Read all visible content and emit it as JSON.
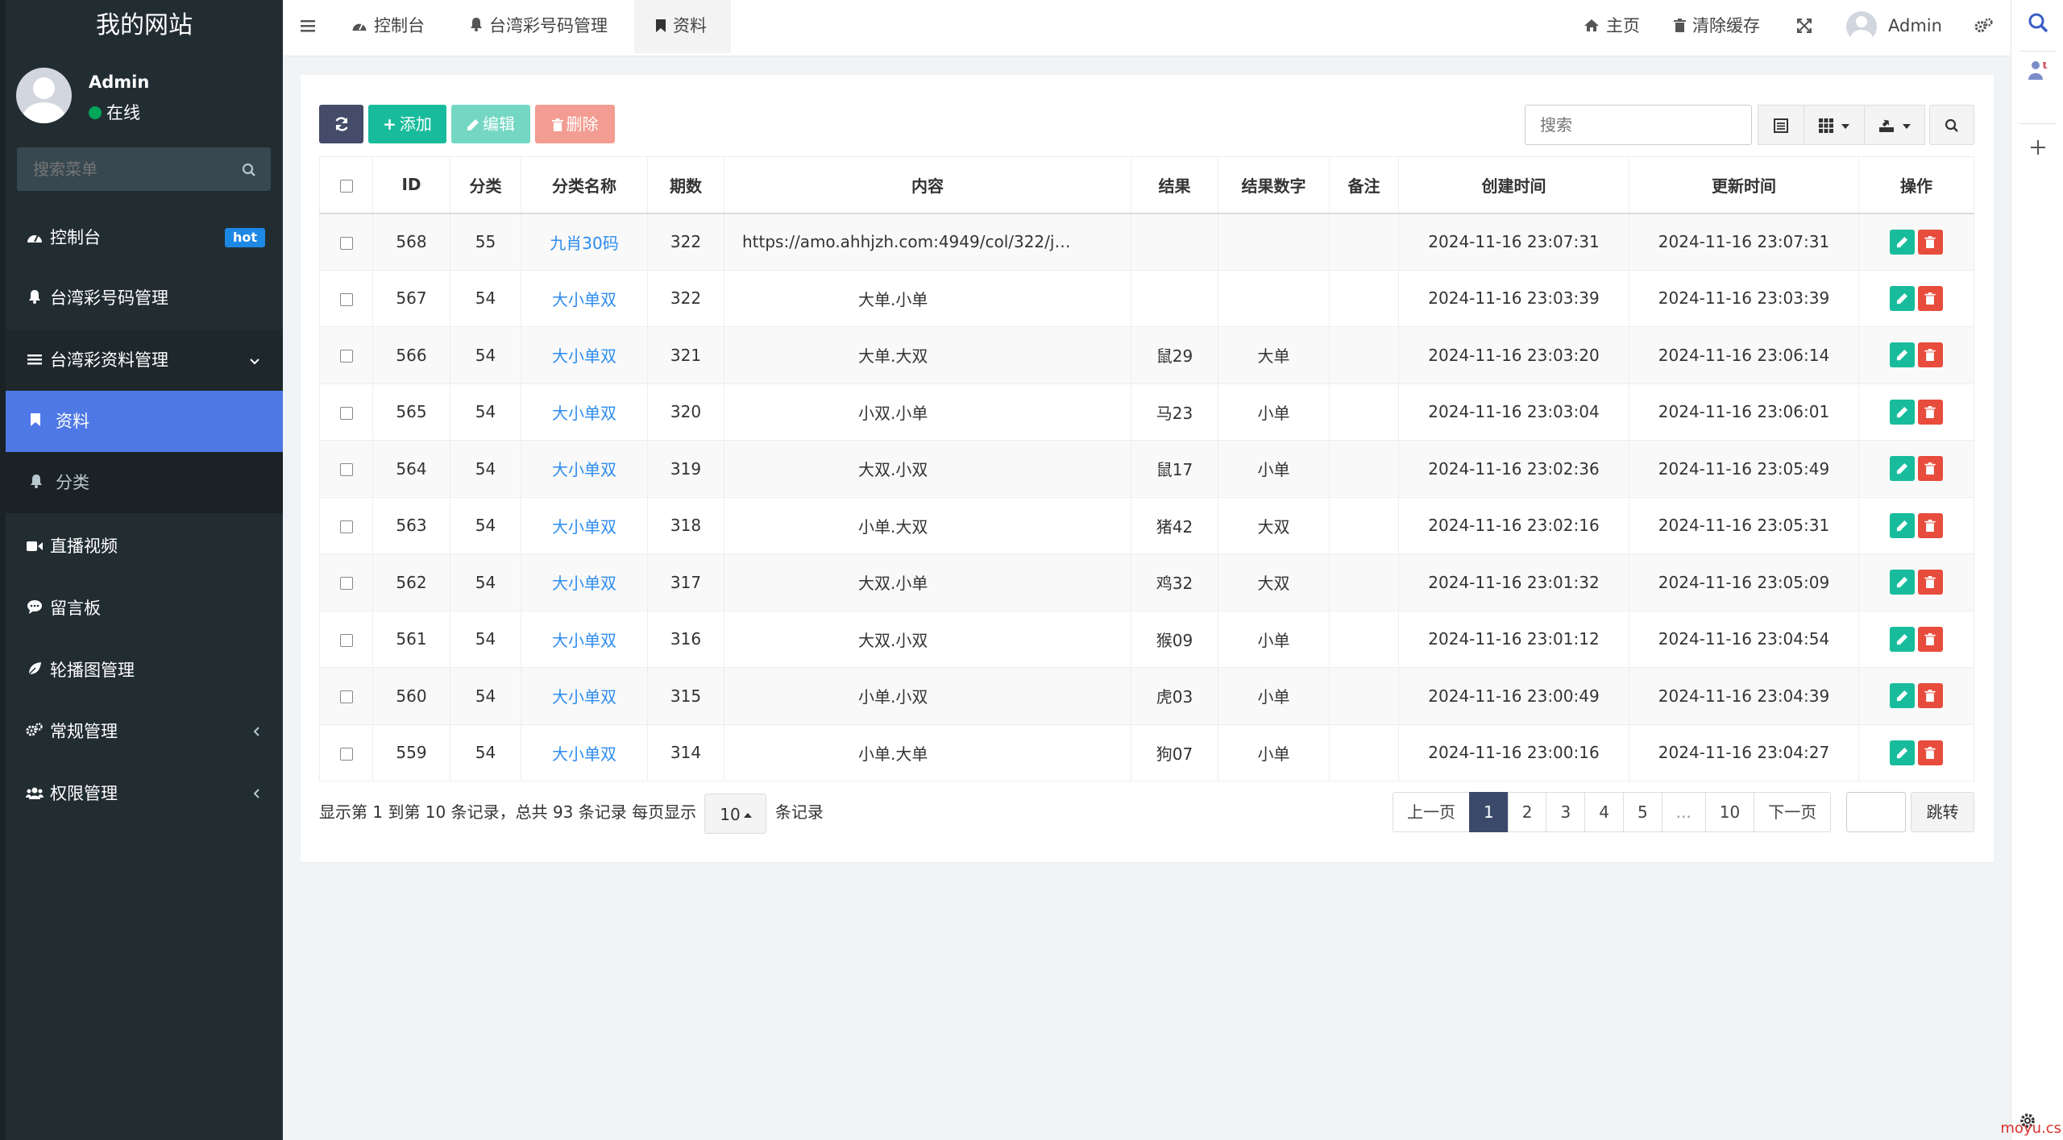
{
  "site_title": "我的网站",
  "user": {
    "name": "Admin",
    "status": "在线"
  },
  "sidebar": {
    "search_placeholder": "搜索菜单",
    "items": [
      {
        "label": "控制台",
        "icon": "dashboard-icon",
        "badge": "hot"
      },
      {
        "label": "台湾彩号码管理",
        "icon": "bell-icon"
      },
      {
        "label": "台湾彩资料管理",
        "icon": "list-icon"
      },
      {
        "label": "资料",
        "icon": "bookmark-icon"
      },
      {
        "label": "分类",
        "icon": "bell-icon"
      },
      {
        "label": "直播视频",
        "icon": "video-icon"
      },
      {
        "label": "留言板",
        "icon": "comment-icon"
      },
      {
        "label": "轮播图管理",
        "icon": "leaf-icon"
      },
      {
        "label": "常规管理",
        "icon": "cogs-icon"
      },
      {
        "label": "权限管理",
        "icon": "users-icon"
      }
    ]
  },
  "topbar": {
    "tabs": [
      {
        "label": "控制台",
        "icon": "dashboard-icon"
      },
      {
        "label": "台湾彩号码管理",
        "icon": "bell-icon"
      },
      {
        "label": "资料",
        "icon": "bookmark-icon"
      }
    ],
    "home": "主页",
    "clear_cache": "清除缓存",
    "admin": "Admin"
  },
  "toolbar": {
    "add": "添加",
    "edit": "编辑",
    "delete": "删除",
    "search_placeholder": "搜索"
  },
  "table": {
    "headers": [
      "ID",
      "分类",
      "分类名称",
      "期数",
      "内容",
      "结果",
      "结果数字",
      "备注",
      "创建时间",
      "更新时间",
      "操作"
    ],
    "rows": [
      {
        "id": "568",
        "cat": "55",
        "cat_name": "九肖30码",
        "issue": "322",
        "content": "https://amo.ahhjzh.com:4949/col/322/j…",
        "result": "",
        "result_num": "",
        "note": "",
        "created": "2024-11-16 23:07:31",
        "updated": "2024-11-16 23:07:31"
      },
      {
        "id": "567",
        "cat": "54",
        "cat_name": "大小单双",
        "issue": "322",
        "content": "大单.小单",
        "result": "",
        "result_num": "",
        "note": "",
        "created": "2024-11-16 23:03:39",
        "updated": "2024-11-16 23:03:39"
      },
      {
        "id": "566",
        "cat": "54",
        "cat_name": "大小单双",
        "issue": "321",
        "content": "大单.大双",
        "result": "鼠29",
        "result_num": "大单",
        "note": "",
        "created": "2024-11-16 23:03:20",
        "updated": "2024-11-16 23:06:14"
      },
      {
        "id": "565",
        "cat": "54",
        "cat_name": "大小单双",
        "issue": "320",
        "content": "小双.小单",
        "result": "马23",
        "result_num": "小单",
        "note": "",
        "created": "2024-11-16 23:03:04",
        "updated": "2024-11-16 23:06:01"
      },
      {
        "id": "564",
        "cat": "54",
        "cat_name": "大小单双",
        "issue": "319",
        "content": "大双.小双",
        "result": "鼠17",
        "result_num": "小单",
        "note": "",
        "created": "2024-11-16 23:02:36",
        "updated": "2024-11-16 23:05:49"
      },
      {
        "id": "563",
        "cat": "54",
        "cat_name": "大小单双",
        "issue": "318",
        "content": "小单.大双",
        "result": "猪42",
        "result_num": "大双",
        "note": "",
        "created": "2024-11-16 23:02:16",
        "updated": "2024-11-16 23:05:31"
      },
      {
        "id": "562",
        "cat": "54",
        "cat_name": "大小单双",
        "issue": "317",
        "content": "大双.小单",
        "result": "鸡32",
        "result_num": "大双",
        "note": "",
        "created": "2024-11-16 23:01:32",
        "updated": "2024-11-16 23:05:09"
      },
      {
        "id": "561",
        "cat": "54",
        "cat_name": "大小单双",
        "issue": "316",
        "content": "大双.小双",
        "result": "猴09",
        "result_num": "小单",
        "note": "",
        "created": "2024-11-16 23:01:12",
        "updated": "2024-11-16 23:04:54"
      },
      {
        "id": "560",
        "cat": "54",
        "cat_name": "大小单双",
        "issue": "315",
        "content": "小单.小双",
        "result": "虎03",
        "result_num": "小单",
        "note": "",
        "created": "2024-11-16 23:00:49",
        "updated": "2024-11-16 23:04:39"
      },
      {
        "id": "559",
        "cat": "54",
        "cat_name": "大小单双",
        "issue": "314",
        "content": "小单.大单",
        "result": "狗07",
        "result_num": "小单",
        "note": "",
        "created": "2024-11-16 23:00:16",
        "updated": "2024-11-16 23:04:27"
      }
    ]
  },
  "footer": {
    "summary": "显示第 1 到第 10 条记录，总共 93 条记录 每页显示",
    "page_size": "10",
    "records_suffix": "条记录",
    "pages": [
      "上一页",
      "1",
      "2",
      "3",
      "4",
      "5",
      "...",
      "10",
      "下一页"
    ],
    "jump": "跳转"
  },
  "watermark": "moyu.cs",
  "colors": {
    "sidebar_bg": "#222d32",
    "active_sub": "#4e78e5",
    "success": "#18bc9c",
    "danger": "#e74c3c",
    "link": "#2d8cf0"
  }
}
